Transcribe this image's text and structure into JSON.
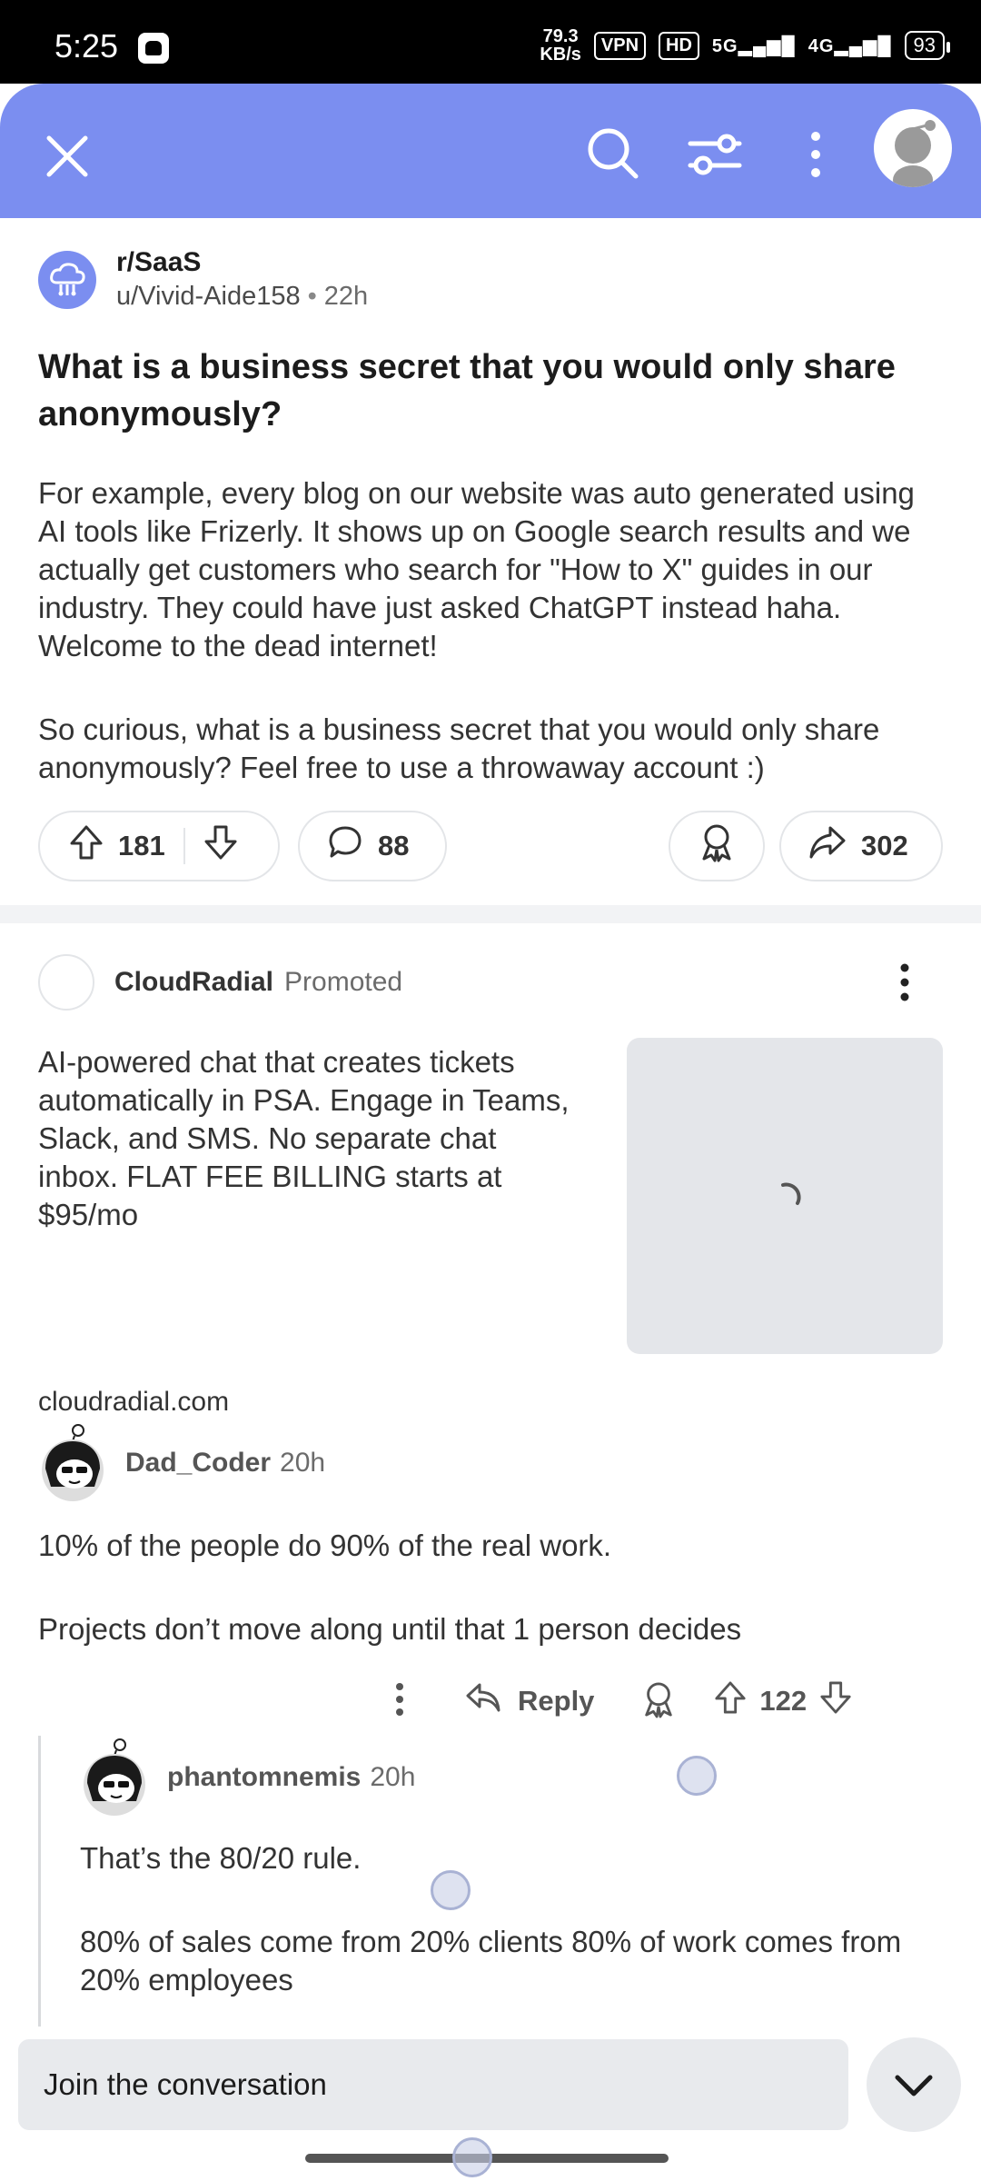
{
  "status_bar": {
    "time": "5:25",
    "net_speed_value": "79.3",
    "net_speed_unit": "KB/s",
    "vpn": "VPN",
    "hd": "HD",
    "signal_5g": "5G",
    "signal_4g": "4G",
    "battery": "93"
  },
  "toolbar": {
    "icons": [
      "close-icon",
      "search-icon",
      "filter-icon",
      "more-vertical-icon",
      "avatar"
    ],
    "accent": "#7b8ef0"
  },
  "post": {
    "subreddit": "r/SaaS",
    "author": "u/Vivid-Aide158",
    "separator": "•",
    "age": "22h",
    "title": "What is a business secret that you would only share anonymously?",
    "body_p1": "For example, every blog on our website was auto generated using AI tools like Frizerly. It shows up on Google search results and we actually get customers who search for \"How to X\" guides in our industry. They could have just asked ChatGPT instead haha. Welcome to the dead internet!",
    "body_p2": "So curious, what is a business secret that you would only share anonymously? Feel free to use a throwaway account :)",
    "upvotes": "181",
    "comments": "88",
    "shares": "302"
  },
  "ad": {
    "advertiser": "CloudRadial",
    "label": "Promoted",
    "text": "AI-powered chat that creates tickets automatically in PSA. Engage in Teams, Slack, and SMS. No separate chat inbox. FLAT FEE BILLING starts at $95/mo",
    "domain": "cloudradial.com"
  },
  "comments": [
    {
      "author": "Dad_Coder",
      "age": "20h",
      "p1": "10% of the people do 90% of the real work.",
      "p2": "Projects don’t move along until that 1 person decides",
      "reply_label": "Reply",
      "score": "122"
    },
    {
      "author": "phantomnemis",
      "age": "20h",
      "p1": "That’s the 80/20 rule.",
      "p2": "80% of sales come from 20% clients 80% of work comes from 20% employees"
    }
  ],
  "bottom": {
    "join_placeholder": "Join the conversation"
  }
}
